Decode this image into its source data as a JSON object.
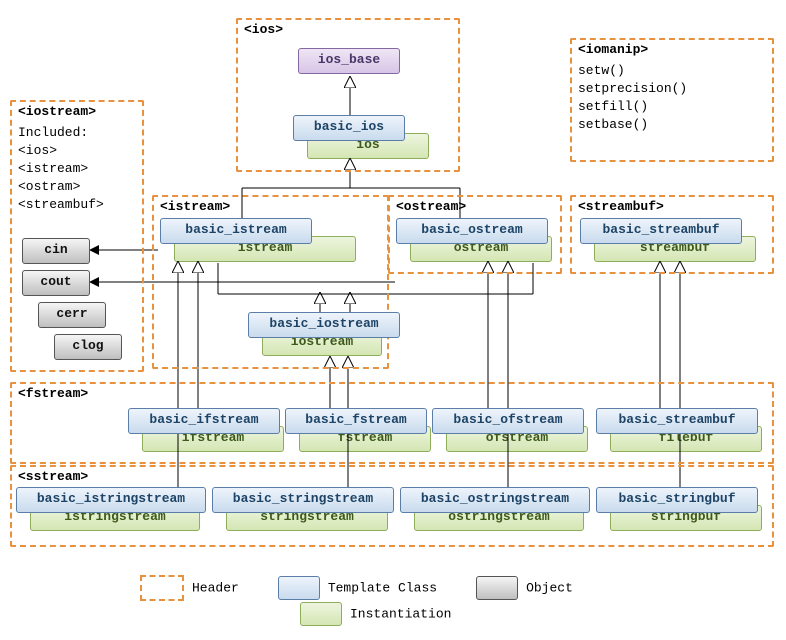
{
  "headers": {
    "ios": {
      "label": "<ios>"
    },
    "iomanip": {
      "label": "<iomanip>",
      "lines": [
        "setw()",
        "setprecision()",
        "setfill()",
        "setbase()"
      ]
    },
    "iostream": {
      "label": "<iostream>",
      "lines": [
        "Included:",
        "<ios>",
        "<istream>",
        "<ostram>",
        "<streambuf>"
      ]
    },
    "istream": {
      "label": "<istream>"
    },
    "ostream": {
      "label": "<ostream>"
    },
    "streambuf": {
      "label": "<streambuf>"
    },
    "fstream": {
      "label": "<fstream>"
    },
    "sstream": {
      "label": "<sstream>"
    }
  },
  "classes": {
    "ios_base": {
      "tpl": "ios_base"
    },
    "basic_ios": {
      "tpl": "basic_ios",
      "inst": "ios"
    },
    "basic_istream": {
      "tpl": "basic_istream",
      "inst": "istream"
    },
    "basic_ostream": {
      "tpl": "basic_ostream",
      "inst": "ostream"
    },
    "basic_iostream": {
      "tpl": "basic_iostream",
      "inst": "iostream"
    },
    "basic_streambuf": {
      "tpl": "basic_streambuf",
      "inst": "streambuf"
    },
    "basic_ifstream": {
      "tpl": "basic_ifstream",
      "inst": "ifstream"
    },
    "basic_fstream": {
      "tpl": "basic_fstream",
      "inst": "fstream"
    },
    "basic_ofstream": {
      "tpl": "basic_ofstream",
      "inst": "ofstream"
    },
    "basic_filebuf": {
      "tpl": "basic_streambuf",
      "inst": "filebuf"
    },
    "basic_istringstream": {
      "tpl": "basic_istringstream",
      "inst": "istringstream"
    },
    "basic_stringstream": {
      "tpl": "basic_stringstream",
      "inst": "stringstream"
    },
    "basic_ostringstream": {
      "tpl": "basic_ostringstream",
      "inst": "ostringstream"
    },
    "basic_stringbuf": {
      "tpl": "basic_stringbuf",
      "inst": "stringbuf"
    }
  },
  "objects": {
    "cin": "cin",
    "cout": "cout",
    "cerr": "cerr",
    "clog": "clog"
  },
  "legend": {
    "header": "Header",
    "tpl": "Template Class",
    "inst": "Instantiation",
    "obj": "Object"
  }
}
